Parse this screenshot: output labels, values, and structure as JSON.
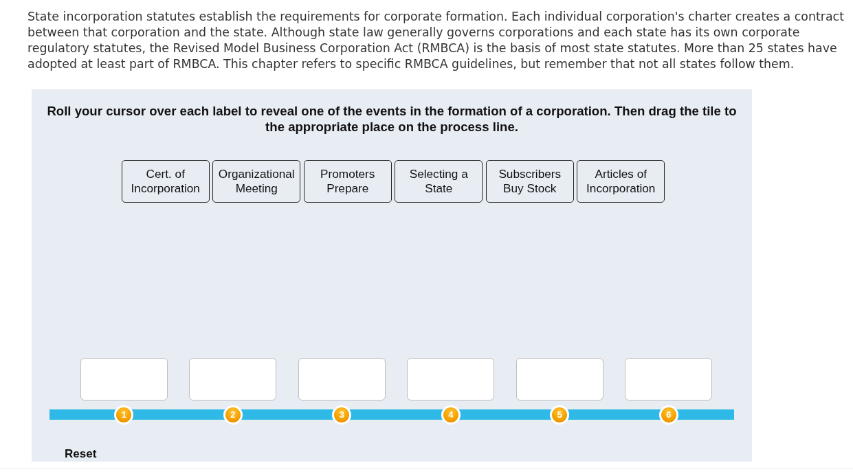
{
  "intro": "State incorporation statutes establish the requirements for corporate formation. Each individual corporation's charter creates a contract between that corporation and the state. Although state law generally governs corporations and each state has its own corporate regulatory statutes, the Revised Model Business Corporation Act (RMBCA) is the basis of most state statutes. More than 25 states have adopted at least part of RMBCA. This chapter refers to specific RMBCA guidelines, but remember that not all states follow them.",
  "activity": {
    "instruction": "Roll your cursor over each label to reveal one of the events in the formation of a corporation. Then drag the tile to the appropriate place on the process line.",
    "tiles": [
      {
        "label": "Cert. of Incorporation"
      },
      {
        "label": "Organizational Meeting"
      },
      {
        "label": "Promoters Prepare"
      },
      {
        "label": "Selecting a State"
      },
      {
        "label": "Subscribers Buy Stock"
      },
      {
        "label": "Articles of Incorporation"
      }
    ],
    "process_line": {
      "steps": [
        {
          "number": "1"
        },
        {
          "number": "2"
        },
        {
          "number": "3"
        },
        {
          "number": "4"
        },
        {
          "number": "5"
        },
        {
          "number": "6"
        }
      ]
    },
    "reset": "Reset"
  }
}
